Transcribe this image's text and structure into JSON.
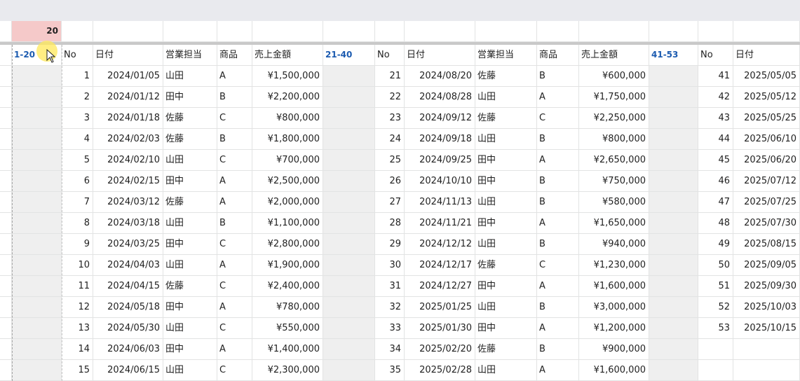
{
  "selected_cell_value": "20",
  "blocks": [
    {
      "group_label": "1-20",
      "headers": {
        "no": "No",
        "date": "日付",
        "rep": "営業担当",
        "product": "商品",
        "amount": "売上金額"
      },
      "rows": [
        {
          "no": "1",
          "date": "2024/01/05",
          "rep": "山田",
          "product": "A",
          "amount": "¥1,500,000"
        },
        {
          "no": "2",
          "date": "2024/01/12",
          "rep": "田中",
          "product": "B",
          "amount": "¥2,200,000"
        },
        {
          "no": "3",
          "date": "2024/01/18",
          "rep": "佐藤",
          "product": "C",
          "amount": "¥800,000"
        },
        {
          "no": "4",
          "date": "2024/02/03",
          "rep": "佐藤",
          "product": "B",
          "amount": "¥1,800,000"
        },
        {
          "no": "5",
          "date": "2024/02/10",
          "rep": "山田",
          "product": "C",
          "amount": "¥700,000"
        },
        {
          "no": "6",
          "date": "2024/02/15",
          "rep": "田中",
          "product": "A",
          "amount": "¥2,500,000"
        },
        {
          "no": "7",
          "date": "2024/03/12",
          "rep": "佐藤",
          "product": "A",
          "amount": "¥2,000,000"
        },
        {
          "no": "8",
          "date": "2024/03/18",
          "rep": "山田",
          "product": "B",
          "amount": "¥1,100,000"
        },
        {
          "no": "9",
          "date": "2024/03/25",
          "rep": "田中",
          "product": "C",
          "amount": "¥2,800,000"
        },
        {
          "no": "10",
          "date": "2024/04/03",
          "rep": "山田",
          "product": "A",
          "amount": "¥1,900,000"
        },
        {
          "no": "11",
          "date": "2024/04/15",
          "rep": "佐藤",
          "product": "C",
          "amount": "¥2,400,000"
        },
        {
          "no": "12",
          "date": "2024/05/18",
          "rep": "田中",
          "product": "A",
          "amount": "¥780,000"
        },
        {
          "no": "13",
          "date": "2024/05/30",
          "rep": "山田",
          "product": "C",
          "amount": "¥550,000"
        },
        {
          "no": "14",
          "date": "2024/06/03",
          "rep": "田中",
          "product": "A",
          "amount": "¥1,400,000"
        },
        {
          "no": "15",
          "date": "2024/06/15",
          "rep": "山田",
          "product": "C",
          "amount": "¥2,300,000"
        }
      ]
    },
    {
      "group_label": "21-40",
      "headers": {
        "no": "No",
        "date": "日付",
        "rep": "営業担当",
        "product": "商品",
        "amount": "売上金額"
      },
      "rows": [
        {
          "no": "21",
          "date": "2024/08/20",
          "rep": "佐藤",
          "product": "B",
          "amount": "¥600,000"
        },
        {
          "no": "22",
          "date": "2024/08/28",
          "rep": "山田",
          "product": "A",
          "amount": "¥1,750,000"
        },
        {
          "no": "23",
          "date": "2024/09/12",
          "rep": "佐藤",
          "product": "C",
          "amount": "¥2,250,000"
        },
        {
          "no": "24",
          "date": "2024/09/18",
          "rep": "山田",
          "product": "B",
          "amount": "¥800,000"
        },
        {
          "no": "25",
          "date": "2024/09/25",
          "rep": "田中",
          "product": "A",
          "amount": "¥2,650,000"
        },
        {
          "no": "26",
          "date": "2024/10/10",
          "rep": "田中",
          "product": "B",
          "amount": "¥750,000"
        },
        {
          "no": "27",
          "date": "2024/11/13",
          "rep": "山田",
          "product": "B",
          "amount": "¥580,000"
        },
        {
          "no": "28",
          "date": "2024/11/21",
          "rep": "田中",
          "product": "A",
          "amount": "¥1,650,000"
        },
        {
          "no": "29",
          "date": "2024/12/12",
          "rep": "山田",
          "product": "B",
          "amount": "¥940,000"
        },
        {
          "no": "30",
          "date": "2024/12/17",
          "rep": "佐藤",
          "product": "C",
          "amount": "¥1,230,000"
        },
        {
          "no": "31",
          "date": "2024/12/27",
          "rep": "田中",
          "product": "A",
          "amount": "¥1,600,000"
        },
        {
          "no": "32",
          "date": "2025/01/25",
          "rep": "山田",
          "product": "B",
          "amount": "¥3,000,000"
        },
        {
          "no": "33",
          "date": "2025/01/30",
          "rep": "田中",
          "product": "A",
          "amount": "¥1,200,000"
        },
        {
          "no": "34",
          "date": "2025/02/20",
          "rep": "佐藤",
          "product": "B",
          "amount": "¥900,000"
        },
        {
          "no": "35",
          "date": "2025/02/28",
          "rep": "山田",
          "product": "A",
          "amount": "¥1,600,000"
        }
      ]
    },
    {
      "group_label": "41-53",
      "headers": {
        "no": "No",
        "date": "日付"
      },
      "rows": [
        {
          "no": "41",
          "date": "2025/05/05"
        },
        {
          "no": "42",
          "date": "2025/05/12"
        },
        {
          "no": "43",
          "date": "2025/05/25"
        },
        {
          "no": "44",
          "date": "2025/06/10"
        },
        {
          "no": "45",
          "date": "2025/06/20"
        },
        {
          "no": "46",
          "date": "2025/07/12"
        },
        {
          "no": "47",
          "date": "2025/07/25"
        },
        {
          "no": "48",
          "date": "2025/07/30"
        },
        {
          "no": "49",
          "date": "2025/08/15"
        },
        {
          "no": "50",
          "date": "2025/09/05"
        },
        {
          "no": "51",
          "date": "2025/09/30"
        },
        {
          "no": "52",
          "date": "2025/10/03"
        },
        {
          "no": "53",
          "date": "2025/10/15"
        },
        {
          "no": "",
          "date": ""
        },
        {
          "no": "",
          "date": ""
        }
      ]
    }
  ],
  "colors": {
    "group_label": "#1c5bb0",
    "selected_cell_bg": "#f5c9c9",
    "gutter_bg": "#efefef",
    "grid": "#e2e3e3"
  },
  "cursor_icon": "mouse-pointer-icon"
}
